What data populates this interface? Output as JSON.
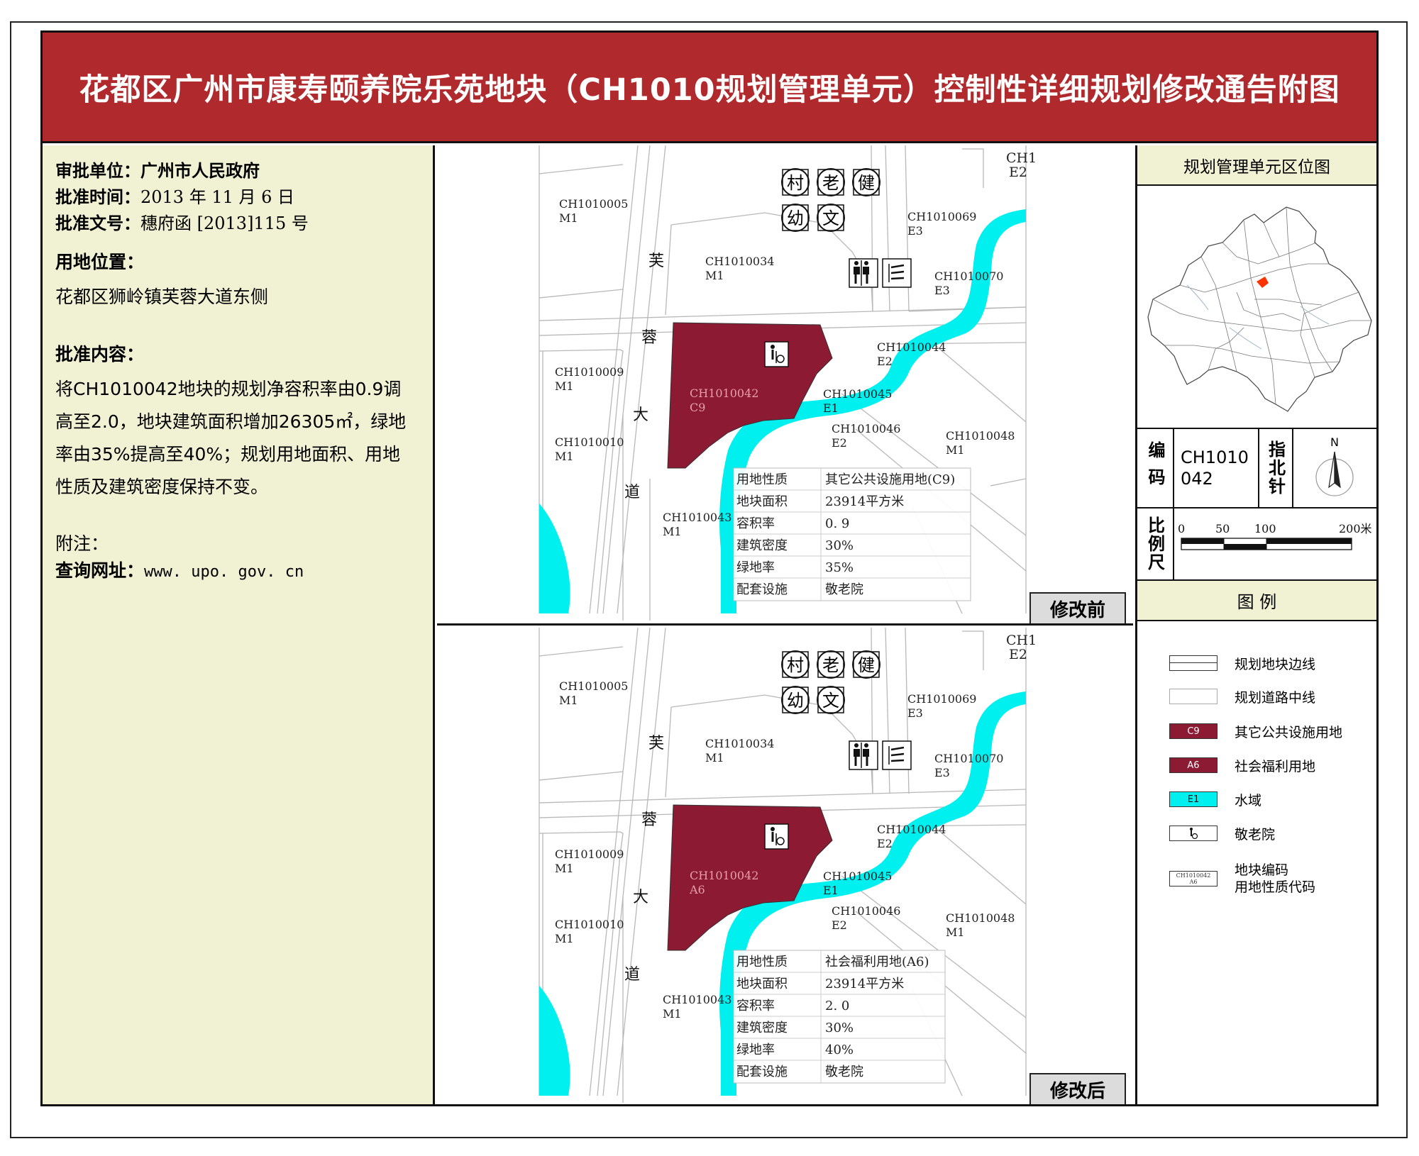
{
  "title": "花都区广州市康寿颐养院乐苑地块（CH1010规划管理单元）控制性详细规划修改通告附图",
  "info": {
    "approval_unit_label": "审批单位：",
    "approval_unit": "广州市人民政府",
    "approval_time_label": "批准时间：",
    "approval_time": "2013 年 11 月 6 日",
    "approval_doc_label": "批准文号：",
    "approval_doc": "穗府函 [2013]115 号",
    "location_label": "用地位置：",
    "location": "花都区狮岭镇芙蓉大道东侧",
    "content_label": "批准内容：",
    "content_lines": [
      "将CH1010042地块的规划净容积率由0.9调",
      "高至2.0，地块建筑面积增加26305㎡，绿地",
      "率由35%提高至40%；规划用地面积、用地",
      "性质及建筑密度保持不变。"
    ],
    "note_label": "附注：",
    "query_label": "查询网址：",
    "query_url": "www. upo. gov. cn"
  },
  "road_chars": [
    "芙",
    "蓉",
    "大",
    "道"
  ],
  "facility_icons": [
    "村",
    "老",
    "健",
    "幼",
    "文"
  ],
  "parcels_common": {
    "p005": [
      "CH1010005",
      "M1"
    ],
    "p034": [
      "CH1010034",
      "M1"
    ],
    "p069": [
      "CH1010069",
      "E3"
    ],
    "p070": [
      "CH1010070",
      "E3"
    ],
    "p044": [
      "CH1010044",
      "E2"
    ],
    "p045": [
      "CH1010045",
      "E1"
    ],
    "p046": [
      "CH1010046",
      "E2"
    ],
    "p048": [
      "CH1010048",
      "M1"
    ],
    "p009": [
      "CH1010009",
      "M1"
    ],
    "p010": [
      "CH1010010",
      "M1"
    ],
    "p043": [
      "CH1010043",
      "M1"
    ],
    "pch1": [
      "CH1",
      "E2"
    ]
  },
  "before": {
    "stamp": "修改前",
    "parcel_code": "CH1010042",
    "parcel_type": "C9",
    "table": [
      [
        "用地性质",
        "其它公共设施用地(C9)"
      ],
      [
        "地块面积",
        "23914平方米"
      ],
      [
        "容积率",
        "0. 9"
      ],
      [
        "建筑密度",
        "30%"
      ],
      [
        "绿地率",
        "35%"
      ],
      [
        "配套设施",
        "敬老院"
      ]
    ]
  },
  "after": {
    "stamp": "修改后",
    "parcel_code": "CH1010042",
    "parcel_type": "A6",
    "table": [
      [
        "用地性质",
        "社会福利用地(A6)"
      ],
      [
        "地块面积",
        "23914平方米"
      ],
      [
        "容积率",
        "2. 0"
      ],
      [
        "建筑密度",
        "30%"
      ],
      [
        "绿地率",
        "40%"
      ],
      [
        "配套设施",
        "敬老院"
      ]
    ]
  },
  "right": {
    "locmap_title": "规划管理单元区位图",
    "code_label": "编码",
    "code_value": "CH1010042",
    "compass_label": "指北针",
    "compass_n": "N",
    "scale_label": "比例尺",
    "scale_ticks": [
      "0",
      "50",
      "100",
      "200米"
    ],
    "legend_title": "图  例",
    "legend": [
      {
        "text": "规划地块边线"
      },
      {
        "text": "规划道路中线"
      },
      {
        "code": "C9",
        "text": "其它公共设施用地"
      },
      {
        "code": "A6",
        "text": "社会福利用地"
      },
      {
        "code": "E1",
        "text": "水域"
      },
      {
        "text": "敬老院"
      },
      {
        "text": "地块编码",
        "text2": "用地性质代码",
        "code": "CH1010042",
        "code2": "A6"
      }
    ]
  },
  "colors": {
    "header": "#b0292d",
    "parcel": "#8b1a32",
    "water": "#00f0f0",
    "panel": "#f1f1d4",
    "locator_marker": "#ff3300"
  }
}
